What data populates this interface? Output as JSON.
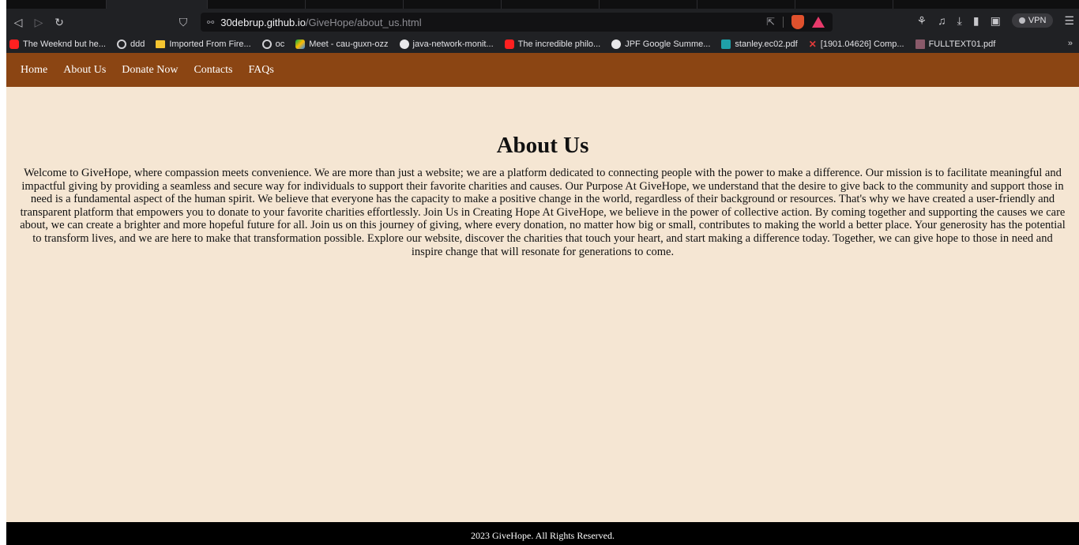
{
  "browser": {
    "url_host": "30debrup.github.io",
    "url_path": "/GiveHope/about_us.html",
    "vpn_label": "VPN",
    "bookmarks": [
      {
        "label": "The Weeknd but he...",
        "icon": "youtube-icon"
      },
      {
        "label": "ddd",
        "icon": "globe-icon"
      },
      {
        "label": "Imported From Fire...",
        "icon": "folder-icon"
      },
      {
        "label": "oc",
        "icon": "globe-icon"
      },
      {
        "label": "Meet - cau-guxn-ozz",
        "icon": "meet-icon"
      },
      {
        "label": "java-network-monit...",
        "icon": "github-icon"
      },
      {
        "label": "The incredible philo...",
        "icon": "youtube-icon"
      },
      {
        "label": "JPF Google Summe...",
        "icon": "github-icon"
      },
      {
        "label": "stanley.ec02.pdf",
        "icon": "nn-icon"
      },
      {
        "label": "[1901.04626] Comp...",
        "icon": "arxiv-icon"
      },
      {
        "label": "FULLTEXT01.pdf",
        "icon": "pdf-icon"
      }
    ],
    "bookmarks_more": "»"
  },
  "site": {
    "nav": [
      "Home",
      "About Us",
      "Donate Now",
      "Contacts",
      "FAQs"
    ],
    "title": "About Us",
    "body": "Welcome to GiveHope, where compassion meets convenience. We are more than just a website; we are a platform dedicated to connecting people with the power to make a difference. Our mission is to facilitate meaningful and impactful giving by providing a seamless and secure way for individuals to support their favorite charities and causes. Our Purpose At GiveHope, we understand that the desire to give back to the community and support those in need is a fundamental aspect of the human spirit. We believe that everyone has the capacity to make a positive change in the world, regardless of their background or resources. That's why we have created a user-friendly and transparent platform that empowers you to donate to your favorite charities effortlessly. Join Us in Creating Hope At GiveHope, we believe in the power of collective action. By coming together and supporting the causes we care about, we can create a brighter and more hopeful future for all. Join us on this journey of giving, where every donation, no matter how big or small, contributes to making the world a better place. Your generosity has the potential to transform lives, and we are here to make that transformation possible. Explore our website, discover the charities that touch your heart, and start making a difference today. Together, we can give hope to those in need and inspire change that will resonate for generations to come.",
    "footer": "2023 GiveHope. All Rights Reserved."
  },
  "colors": {
    "nav_bg": "#8b4513",
    "page_bg": "#f5e6d3",
    "footer_bg": "#000000"
  }
}
